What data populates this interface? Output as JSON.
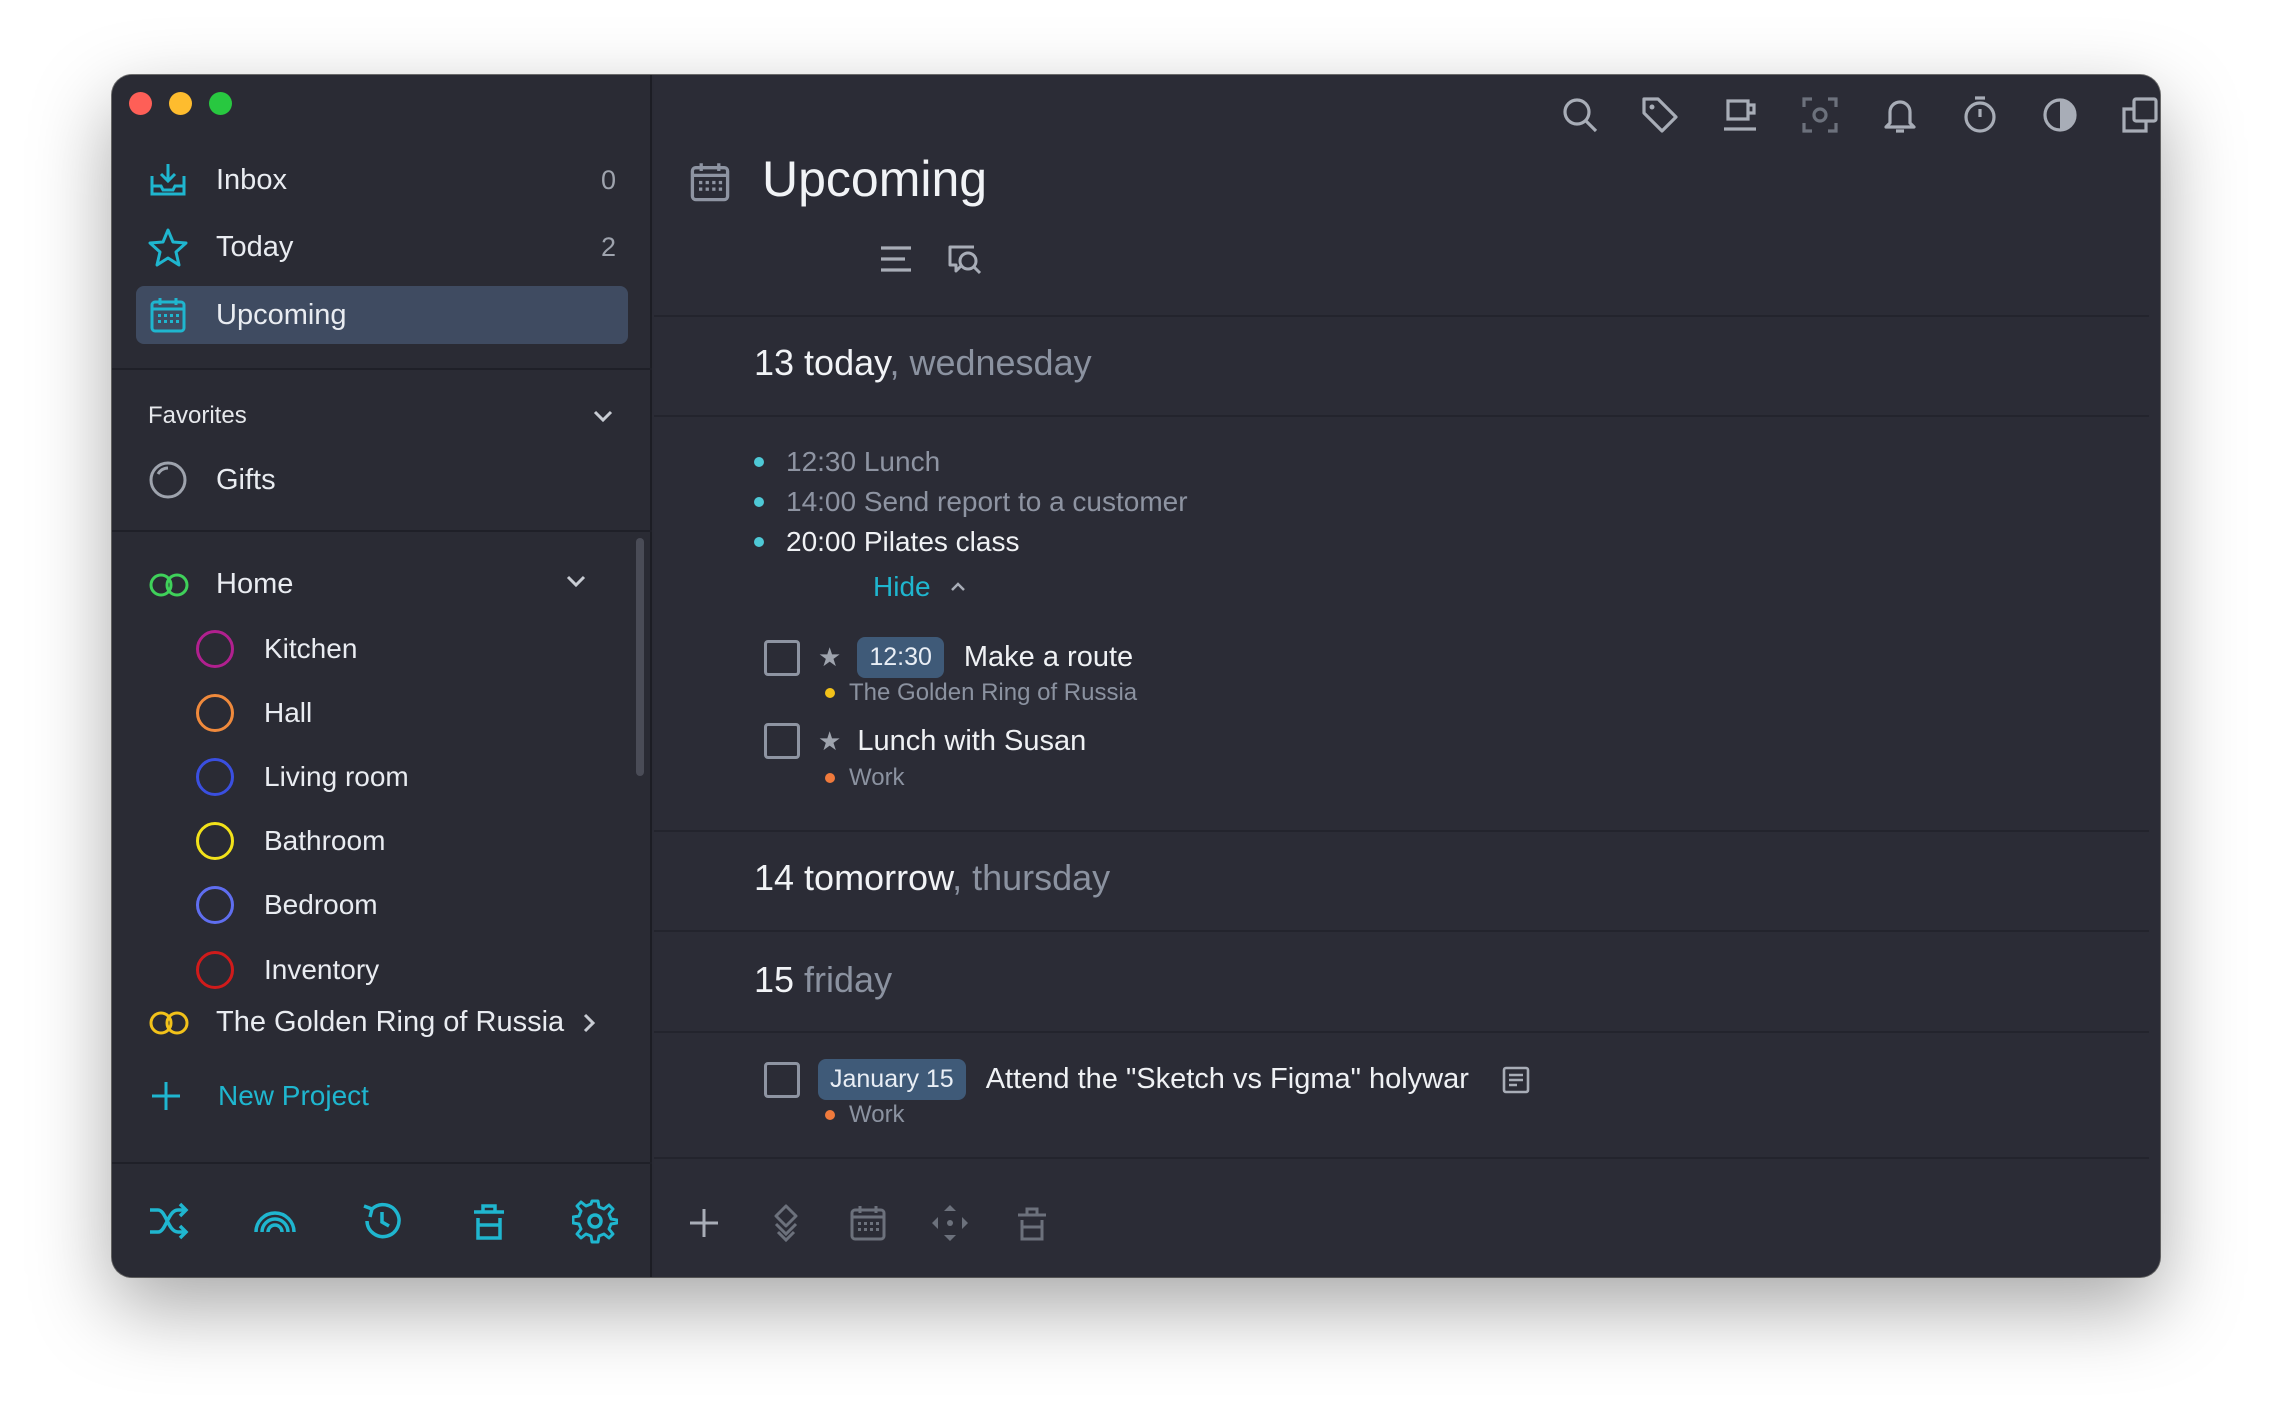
{
  "colors": {
    "accent": "#1fb6cf",
    "sidebar_bg": "#2a2b34",
    "main_bg": "#2b2c36",
    "selection": "#3f4b61"
  },
  "sidebar": {
    "nav": [
      {
        "label": "Inbox",
        "count": "0",
        "icon": "inbox-icon"
      },
      {
        "label": "Today",
        "count": "2",
        "icon": "star-icon"
      },
      {
        "label": "Upcoming",
        "count": "",
        "icon": "calendar-icon"
      }
    ],
    "favorites_title": "Favorites",
    "favorites": [
      {
        "label": "Gifts",
        "icon": "progress-circle-icon"
      }
    ],
    "projects": [
      {
        "label": "Home",
        "color": "#3fd15a",
        "expanded": true,
        "children": [
          {
            "label": "Kitchen",
            "color": "#b1208f"
          },
          {
            "label": "Hall",
            "color": "#f08a3c"
          },
          {
            "label": "Living room",
            "color": "#3a4fe0"
          },
          {
            "label": "Bathroom",
            "color": "#f2e21a"
          },
          {
            "label": "Bedroom",
            "color": "#5f6ef0"
          },
          {
            "label": "Inventory",
            "color": "#d01b1b"
          }
        ]
      },
      {
        "label": "The Golden Ring of Russia",
        "color": "#f2c21a",
        "expanded": false
      }
    ],
    "new_project": "New Project",
    "bottom_icons": [
      "shuffle-icon",
      "rainbow-icon",
      "history-icon",
      "trash-icon",
      "settings-icon"
    ]
  },
  "main": {
    "toolbar_icons": [
      "search-icon",
      "tag-icon",
      "cup-icon",
      "focus-icon",
      "bell-icon",
      "timer-icon",
      "contrast-icon",
      "windows-icon"
    ],
    "title": "Upcoming",
    "days": [
      {
        "day": "13 today",
        "weekday": ", wednesday",
        "events": [
          {
            "text": "12:30 Lunch",
            "past": true
          },
          {
            "text": "14:00 Send report to a customer",
            "past": true
          },
          {
            "text": "20:00 Pilates class",
            "past": false
          }
        ],
        "hide_label": "Hide",
        "tasks": [
          {
            "time": "12:30",
            "title": "Make a route",
            "project": "The Golden Ring of Russia",
            "project_color": "#f2c21a"
          },
          {
            "time": "",
            "title": "Lunch with Susan",
            "project": "Work",
            "project_color": "#f07a3c"
          }
        ]
      },
      {
        "day": "14 tomorrow",
        "weekday": ", thursday"
      },
      {
        "day": "15",
        "weekday": " friday",
        "tasks": [
          {
            "date": "January 15",
            "title": "Attend the \"Sketch vs Figma\" holywar",
            "project": "Work",
            "project_color": "#f07a3c"
          }
        ]
      }
    ],
    "footer_icons": [
      "add-icon",
      "priority-icon",
      "calendar-icon",
      "move-icon",
      "trash-icon"
    ],
    "sync_icon": "cloud-icon"
  }
}
